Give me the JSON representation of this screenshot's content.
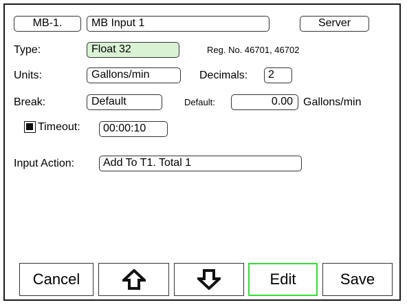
{
  "header": {
    "channel_label": "MB-1.",
    "name_value": "MB Input 1",
    "mode_label": "Server"
  },
  "type": {
    "label": "Type:",
    "value": "Float 32",
    "reg_info": "Reg. No. 46701, 46702"
  },
  "units": {
    "label": "Units:",
    "value": "Gallons/min",
    "decimals_label": "Decimals:",
    "decimals_value": "2"
  },
  "break": {
    "label": "Break:",
    "value": "Default",
    "default_label": "Default:",
    "default_value": "0.00",
    "default_units": "Gallons/min"
  },
  "timeout": {
    "checked": true,
    "label": "Timeout:",
    "value": "00:00:10"
  },
  "input_action": {
    "label": "Input Action:",
    "value": "Add To T1. Total 1"
  },
  "buttons": {
    "cancel": "Cancel",
    "up_icon": "arrow-up-icon",
    "down_icon": "arrow-down-icon",
    "edit": "Edit",
    "save": "Save"
  },
  "colors": {
    "type_field_bg": "#d9f2d4",
    "edit_button_border": "#33dd33"
  }
}
